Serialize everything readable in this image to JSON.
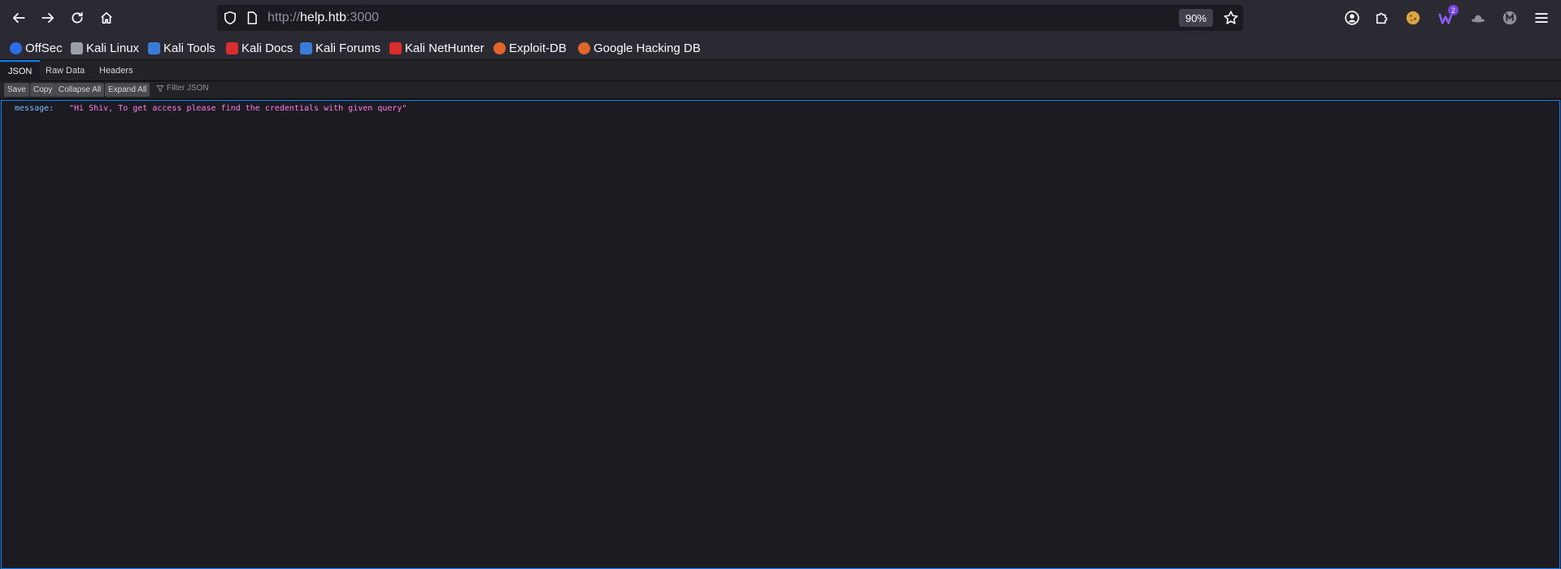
{
  "browser": {
    "url_prefix": "http://",
    "url_host": "help.htb",
    "url_suffix": ":3000",
    "zoom": "90%",
    "extension_badge": "2"
  },
  "bookmarks": [
    {
      "label": "OffSec",
      "icon": "offsec-icon",
      "color": "#2a6ee8"
    },
    {
      "label": "Kali Linux",
      "icon": "kali-dragon-icon",
      "color": "#9aa0a6"
    },
    {
      "label": "Kali Tools",
      "icon": "kali-tools-icon",
      "color": "#3b7bd8"
    },
    {
      "label": "Kali Docs",
      "icon": "kali-docs-icon",
      "color": "#d92c2c"
    },
    {
      "label": "Kali Forums",
      "icon": "kali-forums-icon",
      "color": "#3b7bd8"
    },
    {
      "label": "Kali NetHunter",
      "icon": "nethunter-icon",
      "color": "#d92c2c"
    },
    {
      "label": "Exploit-DB",
      "icon": "exploit-db-icon",
      "color": "#e0662b"
    },
    {
      "label": "Google Hacking DB",
      "icon": "ghdb-icon",
      "color": "#e0662b"
    }
  ],
  "viewer_tabs": [
    {
      "label": "JSON",
      "active": true
    },
    {
      "label": "Raw Data",
      "active": false
    },
    {
      "label": "Headers",
      "active": false
    }
  ],
  "json_toolbar": {
    "save": "Save",
    "copy": "Copy",
    "collapse_all": "Collapse All",
    "expand_all": "Expand All",
    "filter_placeholder": "Filter JSON"
  },
  "json_rows": [
    {
      "key": "message:",
      "value": "\"Hi Shiv, To get access please find the credentials with given query\""
    }
  ]
}
